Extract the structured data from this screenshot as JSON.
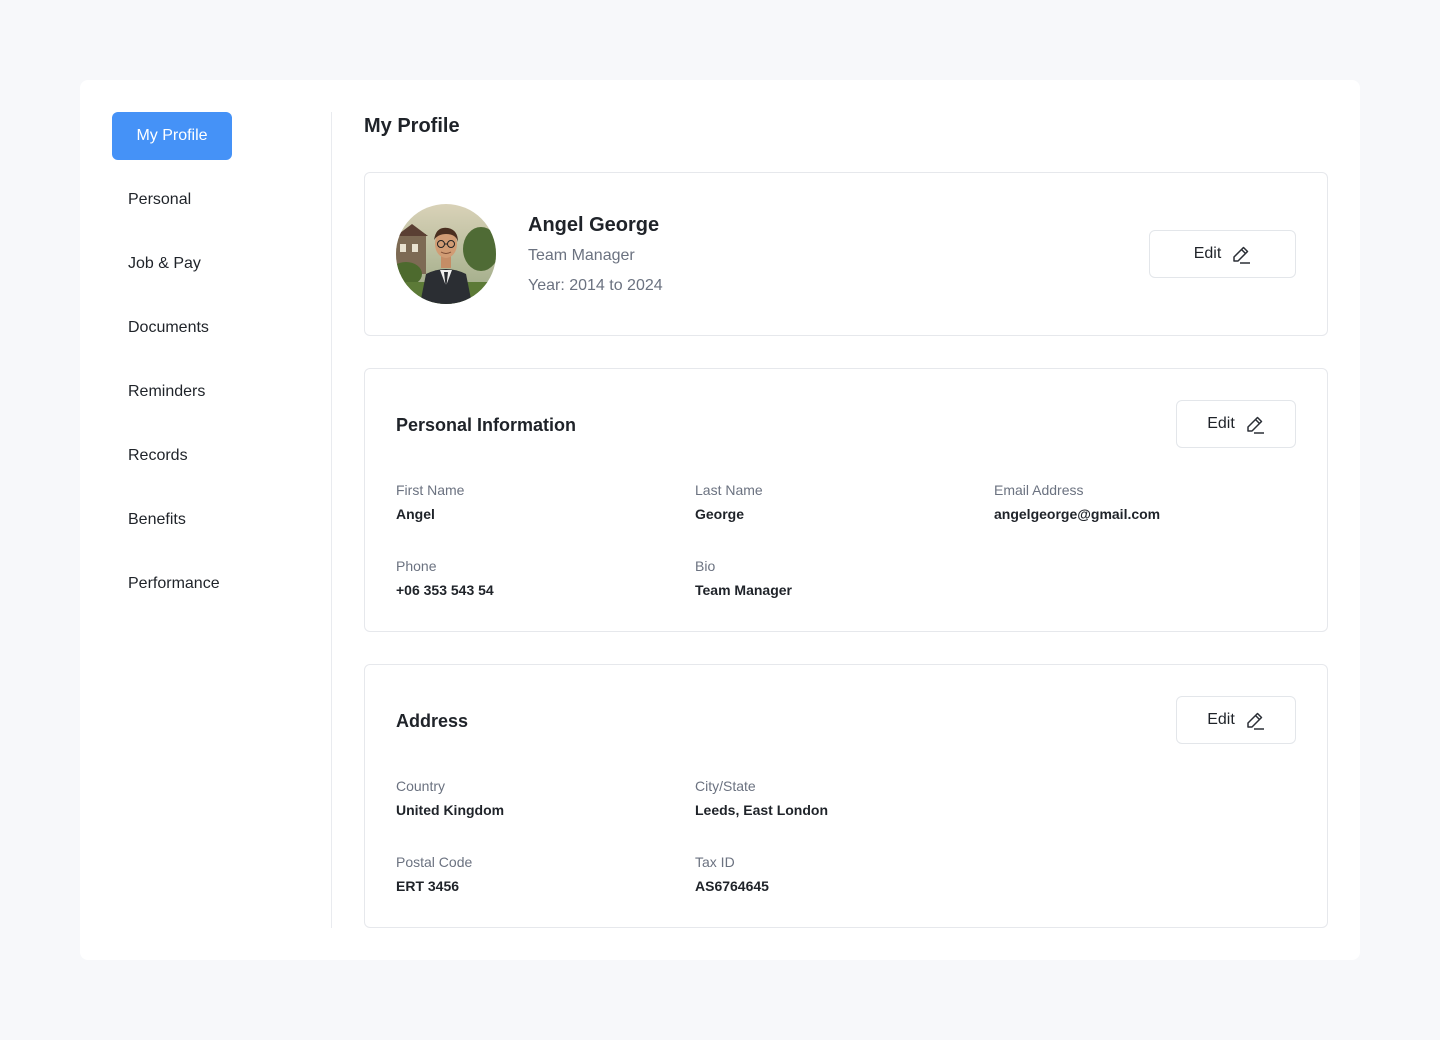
{
  "sidebar": {
    "items": [
      {
        "label": "My Profile",
        "active": true
      },
      {
        "label": "Personal"
      },
      {
        "label": "Job & Pay"
      },
      {
        "label": "Documents"
      },
      {
        "label": "Reminders"
      },
      {
        "label": "Records"
      },
      {
        "label": "Benefits"
      },
      {
        "label": "Performance"
      }
    ]
  },
  "page": {
    "title": "My Profile"
  },
  "profile": {
    "name": "Angel George",
    "role": "Team Manager",
    "years": "Year: 2014 to 2024",
    "edit_label": "Edit"
  },
  "personal": {
    "title": "Personal Information",
    "edit_label": "Edit",
    "fields": {
      "first_name": {
        "label": "First Name",
        "value": "Angel"
      },
      "last_name": {
        "label": "Last Name",
        "value": "George"
      },
      "email": {
        "label": "Email Address",
        "value": "angelgeorge@gmail.com"
      },
      "phone": {
        "label": "Phone",
        "value": "+06 353 543 54"
      },
      "bio": {
        "label": "Bio",
        "value": "Team Manager"
      }
    }
  },
  "address": {
    "title": "Address",
    "edit_label": "Edit",
    "fields": {
      "country": {
        "label": "Country",
        "value": "United Kingdom"
      },
      "city": {
        "label": "City/State",
        "value": "Leeds, East London"
      },
      "postal": {
        "label": "Postal Code",
        "value": "ERT 3456"
      },
      "tax": {
        "label": "Tax ID",
        "value": "AS6764645"
      }
    }
  },
  "icons": {
    "edit": "pencil-icon",
    "avatar": "user-photo"
  },
  "colors": {
    "accent": "#4592f7",
    "background": "#f7f8fa",
    "muted_text": "#6b7280"
  }
}
